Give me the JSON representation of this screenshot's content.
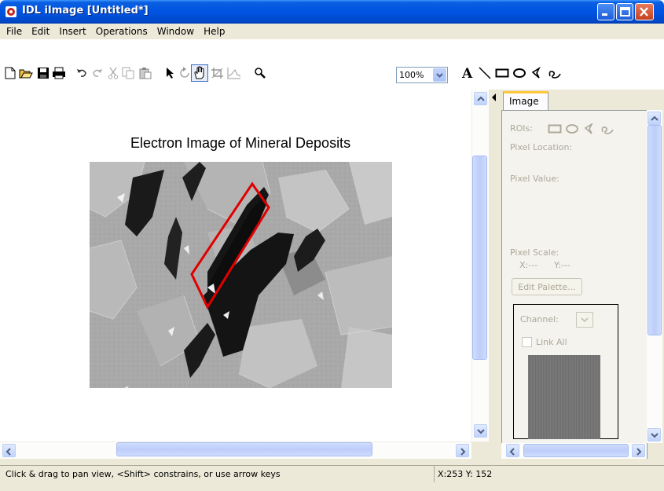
{
  "window": {
    "title": "IDL iImage [Untitled*]"
  },
  "menu": [
    "File",
    "Edit",
    "Insert",
    "Operations",
    "Window",
    "Help"
  ],
  "toolbar": {
    "zoom": "100%",
    "icons": [
      "new-icon",
      "open-icon",
      "save-icon",
      "print-icon",
      "undo-icon",
      "redo-icon",
      "cut-icon",
      "copy-icon",
      "paste-icon",
      "select-arrow-icon",
      "rotate-icon",
      "pan-hand-icon",
      "crop-icon",
      "line-profile-icon",
      "zoom-icon",
      "text-tool-icon",
      "line-tool-icon",
      "rectangle-tool-icon",
      "oval-tool-icon",
      "polygon-tool-icon",
      "freehand-tool-icon"
    ]
  },
  "canvas": {
    "image_title": "Electron Image of Mineral Deposits",
    "roi_color": "#e00000"
  },
  "panel": {
    "tab_label": "Image",
    "rois_label": "ROIs:",
    "pixel_location_label": "Pixel Location:",
    "pixel_value_label": "Pixel Value:",
    "pixel_scale_label": "Pixel Scale:",
    "scale_x": "X:---",
    "scale_y": "Y:---",
    "edit_palette_label": "Edit Palette...",
    "channel_label": "Channel:",
    "link_all_label": "Link All"
  },
  "status": {
    "message": "Click & drag to pan view, <Shift> constrains, or use arrow keys",
    "coords": "X:253 Y: 152"
  }
}
